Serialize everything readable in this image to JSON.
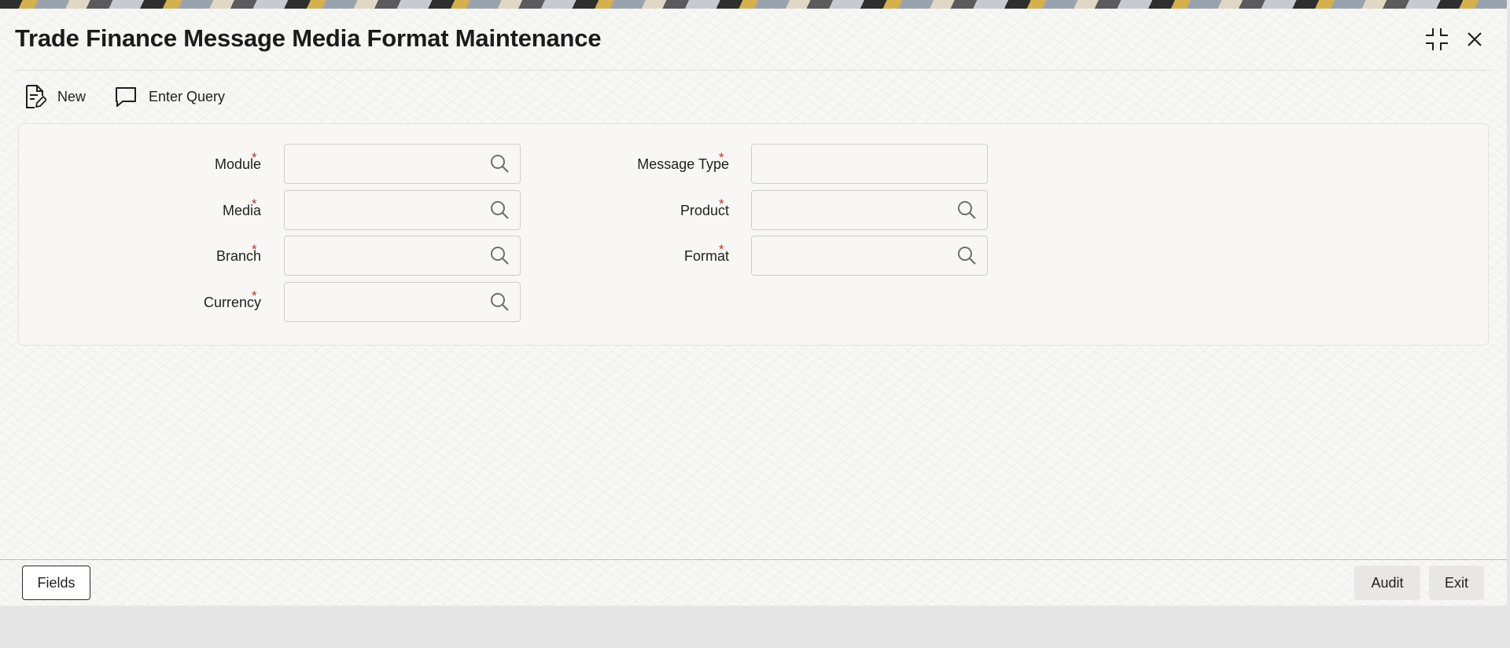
{
  "window": {
    "title": "Trade Finance Message Media Format Maintenance",
    "controls": {
      "minimize_icon": "collapse-icon",
      "close_icon": "close-icon"
    }
  },
  "toolbar": {
    "new_label": "New",
    "enter_query_label": "Enter Query"
  },
  "form": {
    "required_marker": "*",
    "module": {
      "label": "Module",
      "value": ""
    },
    "media": {
      "label": "Media",
      "value": ""
    },
    "branch": {
      "label": "Branch",
      "value": ""
    },
    "currency": {
      "label": "Currency",
      "value": ""
    },
    "message_type": {
      "label": "Message Type",
      "value": ""
    },
    "product": {
      "label": "Product",
      "value": ""
    },
    "format": {
      "label": "Format",
      "value": ""
    }
  },
  "footer": {
    "fields_label": "Fields",
    "audit_label": "Audit",
    "exit_label": "Exit"
  },
  "colors": {
    "required": "#b5372b",
    "border": "#cfcdc8",
    "background": "#f7f7f6"
  }
}
